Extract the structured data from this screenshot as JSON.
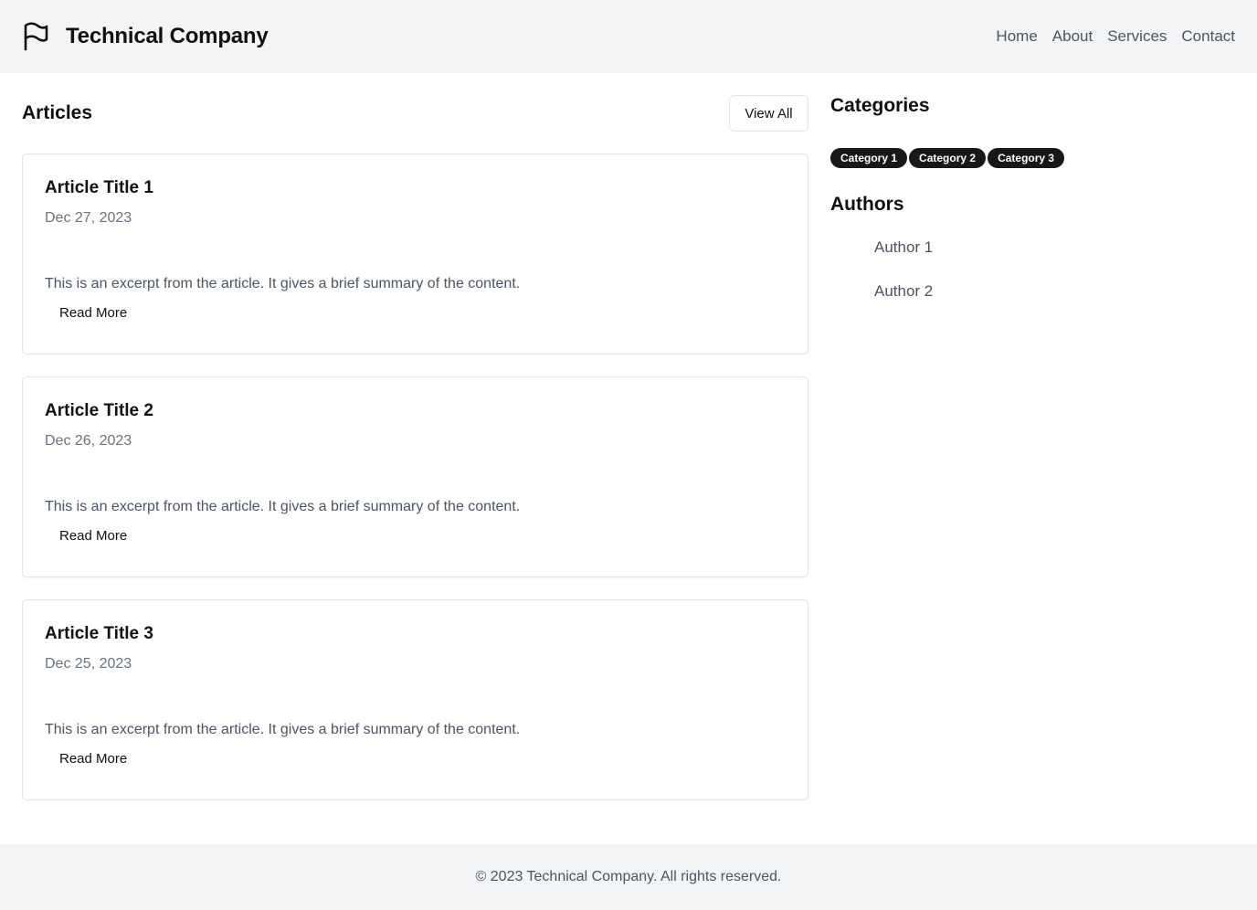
{
  "header": {
    "logo_icon": "flag-icon",
    "company_name": "Technical Company",
    "nav": [
      {
        "label": "Home"
      },
      {
        "label": "About"
      },
      {
        "label": "Services"
      },
      {
        "label": "Contact"
      }
    ]
  },
  "articles": {
    "heading": "Articles",
    "view_all_label": "View All",
    "items": [
      {
        "title": "Article Title 1",
        "date": "Dec 27, 2023",
        "excerpt": "This is an excerpt from the article. It gives a brief summary of the content.",
        "read_more": "Read More"
      },
      {
        "title": "Article Title 2",
        "date": "Dec 26, 2023",
        "excerpt": "This is an excerpt from the article. It gives a brief summary of the content.",
        "read_more": "Read More"
      },
      {
        "title": "Article Title 3",
        "date": "Dec 25, 2023",
        "excerpt": "This is an excerpt from the article. It gives a brief summary of the content.",
        "read_more": "Read More"
      }
    ]
  },
  "sidebar": {
    "categories_heading": "Categories",
    "categories": [
      "Category 1",
      "Category 2",
      "Category 3"
    ],
    "authors_heading": "Authors",
    "authors": [
      "Author 1",
      "Author 2"
    ]
  },
  "footer": {
    "text": "© 2023 Technical Company. All rights reserved."
  },
  "colors": {
    "header_bg": "#f3f4f6",
    "chip_bg": "#18181b",
    "text_muted": "#6b7280",
    "border": "#e5e7eb"
  }
}
